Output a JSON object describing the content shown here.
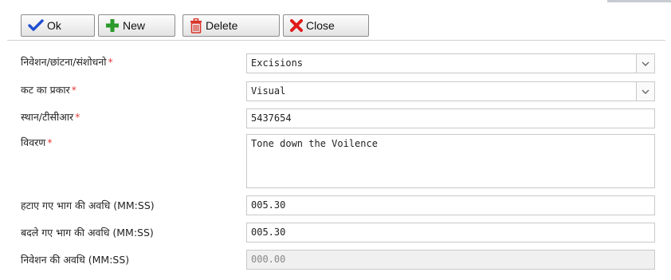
{
  "toolbar": {
    "ok_label": "Ok",
    "new_label": "New",
    "delete_label": "Delete",
    "close_label": "Close",
    "icons": {
      "ok": "checkmark-icon",
      "new": "plus-icon",
      "delete": "trash-icon",
      "close": "x-icon"
    },
    "colors": {
      "ok_icon": "#1f4fd1",
      "new_icon": "#2a9a2a",
      "delete_icon": "#d9342b",
      "close_icon": "#e01b1b"
    }
  },
  "form": {
    "required_marker": "*",
    "fields": [
      {
        "label": "निवेशन/छांटना/संशोधनो",
        "value": "Excisions",
        "type": "select",
        "required": true
      },
      {
        "label": "कट का प्रकार",
        "value": "Visual",
        "type": "select",
        "required": true
      },
      {
        "label": "स्थान/टीसीआर",
        "value": "5437654",
        "type": "text",
        "required": true
      },
      {
        "label": "विवरण",
        "value": "Tone down the Voilence",
        "type": "textarea",
        "required": true
      },
      {
        "label": "हटाए गए भाग की अवधि (MM:SS)",
        "value": "005.30",
        "type": "text",
        "required": false
      },
      {
        "label": "बदले गए भाग की अवधि (MM:SS)",
        "value": "005.30",
        "type": "text",
        "required": false
      },
      {
        "label": "निवेशन की अवधि (MM:SS)",
        "value": "000.00",
        "type": "text",
        "required": false,
        "readonly": true
      }
    ]
  }
}
